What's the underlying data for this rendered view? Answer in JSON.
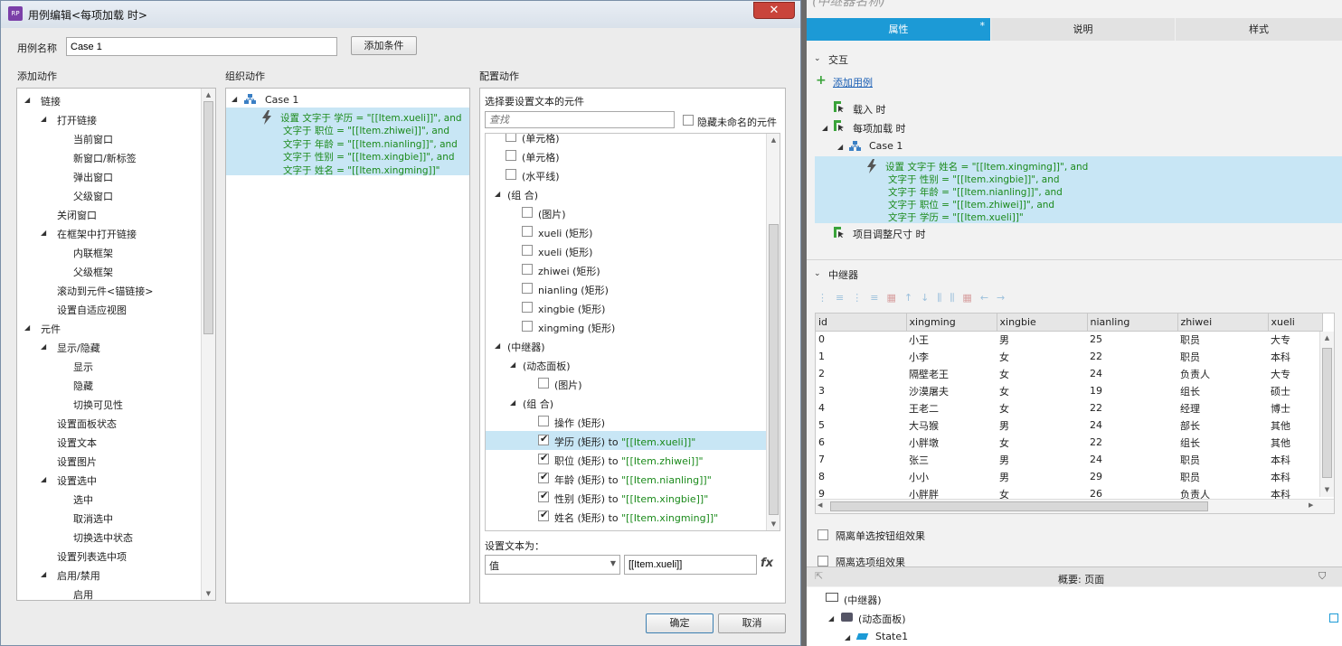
{
  "dialog": {
    "title": "用例编辑<每项加载 时>",
    "case_name_label": "用例名称",
    "case_name_value": "Case 1",
    "add_condition": "添加条件",
    "ok": "确定",
    "cancel": "取消"
  },
  "actions": {
    "header": "添加动作",
    "items": [
      {
        "label": "链接",
        "level": 0,
        "expand": true
      },
      {
        "label": "打开链接",
        "level": 1,
        "expand": true
      },
      {
        "label": "当前窗口",
        "level": 2
      },
      {
        "label": "新窗口/新标签",
        "level": 2
      },
      {
        "label": "弹出窗口",
        "level": 2
      },
      {
        "label": "父级窗口",
        "level": 2
      },
      {
        "label": "关闭窗口",
        "level": 1
      },
      {
        "label": "在框架中打开链接",
        "level": 1,
        "expand": true
      },
      {
        "label": "内联框架",
        "level": 2
      },
      {
        "label": "父级框架",
        "level": 2
      },
      {
        "label": "滚动到元件<锚链接>",
        "level": 1
      },
      {
        "label": "设置自适应视图",
        "level": 1
      },
      {
        "label": "元件",
        "level": 0,
        "expand": true
      },
      {
        "label": "显示/隐藏",
        "level": 1,
        "expand": true
      },
      {
        "label": "显示",
        "level": 2
      },
      {
        "label": "隐藏",
        "level": 2
      },
      {
        "label": "切换可见性",
        "level": 2
      },
      {
        "label": "设置面板状态",
        "level": 1
      },
      {
        "label": "设置文本",
        "level": 1
      },
      {
        "label": "设置图片",
        "level": 1
      },
      {
        "label": "设置选中",
        "level": 1,
        "expand": true
      },
      {
        "label": "选中",
        "level": 2
      },
      {
        "label": "取消选中",
        "level": 2
      },
      {
        "label": "切换选中状态",
        "level": 2
      },
      {
        "label": "设置列表选中项",
        "level": 1
      },
      {
        "label": "启用/禁用",
        "level": 1,
        "expand": true
      },
      {
        "label": "启用",
        "level": 2
      }
    ]
  },
  "organize": {
    "header": "组织动作",
    "case_label": "Case 1",
    "action_lines": [
      "设置 文字于 学历 = \"[[Item.xueli]]\", and",
      "文字于 职位 = \"[[Item.zhiwei]]\", and",
      "文字于 年龄 = \"[[Item.nianling]]\", and",
      "文字于 性别 = \"[[Item.xingbie]]\", and",
      "文字于 姓名 = \"[[Item.xingming]]\""
    ]
  },
  "configure": {
    "header": "配置动作",
    "select_label": "选择要设置文本的元件",
    "search_placeholder": "查找",
    "hide_unnamed": "隐藏未命名的元件",
    "items": [
      {
        "label": "(单元格)",
        "level": 1,
        "checkbox": true,
        "checked": false
      },
      {
        "label": "(单元格)",
        "level": 1,
        "checkbox": true,
        "checked": false
      },
      {
        "label": "(水平线)",
        "level": 1,
        "checkbox": true,
        "checked": false
      },
      {
        "label": "(组 合)",
        "level": 0,
        "checkbox": false,
        "expand": true
      },
      {
        "label": "(图片)",
        "level": 2,
        "checkbox": true,
        "checked": false
      },
      {
        "label": "xueli (矩形)",
        "level": 2,
        "checkbox": true,
        "checked": false
      },
      {
        "label": "xueli (矩形)",
        "level": 2,
        "checkbox": true,
        "checked": false
      },
      {
        "label": "zhiwei (矩形)",
        "level": 2,
        "checkbox": true,
        "checked": false
      },
      {
        "label": "nianling (矩形)",
        "level": 2,
        "checkbox": true,
        "checked": false
      },
      {
        "label": "xingbie (矩形)",
        "level": 2,
        "checkbox": true,
        "checked": false
      },
      {
        "label": "xingming (矩形)",
        "level": 2,
        "checkbox": true,
        "checked": false
      },
      {
        "label": "(中继器)",
        "level": 0,
        "checkbox": false,
        "expand": true
      },
      {
        "label": "(动态面板)",
        "level": 1,
        "checkbox": false,
        "expand": true
      },
      {
        "label": "(图片)",
        "level": 3,
        "checkbox": true,
        "checked": false
      },
      {
        "label": "(组 合)",
        "level": 1,
        "checkbox": false,
        "expand": true
      },
      {
        "label": "操作 (矩形)",
        "level": 3,
        "checkbox": true,
        "checked": false
      },
      {
        "label": "学历 (矩形) to ",
        "suffix": "\"[[Item.xueli]]\"",
        "level": 3,
        "checkbox": true,
        "checked": true,
        "selected": true
      },
      {
        "label": "职位 (矩形) to ",
        "suffix": "\"[[Item.zhiwei]]\"",
        "level": 3,
        "checkbox": true,
        "checked": true
      },
      {
        "label": "年龄 (矩形) to ",
        "suffix": "\"[[Item.nianling]]\"",
        "level": 3,
        "checkbox": true,
        "checked": true
      },
      {
        "label": "性别 (矩形) to ",
        "suffix": "\"[[Item.xingbie]]\"",
        "level": 3,
        "checkbox": true,
        "checked": true
      },
      {
        "label": "姓名 (矩形) to ",
        "suffix": "\"[[Item.xingming]]\"",
        "level": 3,
        "checkbox": true,
        "checked": true
      }
    ],
    "set_text_label": "设置文本为：",
    "value_type": "值",
    "value_text": "[[Item.xueli]]",
    "fx": "fx"
  },
  "right": {
    "widget_name": "(中继器名称)",
    "tabs": [
      "属性",
      "说明",
      "样式"
    ],
    "active_tab_mark": "*",
    "interaction_label": "交互",
    "add_case": "添加用例",
    "events": [
      {
        "label": "载入 时",
        "level": 1
      },
      {
        "label": "每项加载 时",
        "level": 1,
        "expand": true
      },
      {
        "label": "Case 1",
        "level": 2,
        "expand": true
      }
    ],
    "action_lines": [
      "设置 文字于 姓名 = \"[[Item.xingming]]\", and",
      "文字于 性别 = \"[[Item.xingbie]]\", and",
      "文字于 年龄 = \"[[Item.nianling]]\", and",
      "文字于 职位 = \"[[Item.zhiwei]]\", and",
      "文字于 学历 = \"[[Item.xueli]]\""
    ],
    "resize_event": "项目调整尺寸 时",
    "repeater_label": "中继器",
    "columns": [
      "id",
      "xingming",
      "xingbie",
      "nianling",
      "zhiwei",
      "xueli"
    ],
    "rows": [
      [
        "0",
        "小王",
        "男",
        "25",
        "职员",
        "大专"
      ],
      [
        "1",
        "小李",
        "女",
        "22",
        "职员",
        "本科"
      ],
      [
        "2",
        "隔壁老王",
        "女",
        "24",
        "负责人",
        "大专"
      ],
      [
        "3",
        "沙漠屠夫",
        "女",
        "19",
        "组长",
        "硕士"
      ],
      [
        "4",
        "王老二",
        "女",
        "22",
        "经理",
        "博士"
      ],
      [
        "5",
        "大马猴",
        "男",
        "24",
        "部长",
        "其他"
      ],
      [
        "6",
        "小胖墩",
        "女",
        "22",
        "组长",
        "其他"
      ],
      [
        "7",
        "张三",
        "男",
        "24",
        "职员",
        "本科"
      ],
      [
        "8",
        "小小",
        "男",
        "29",
        "职员",
        "本科"
      ],
      [
        "9",
        "小胖胖",
        "女",
        "26",
        "负责人",
        "本科"
      ]
    ],
    "isolate_radio": "隔离单选按钮组效果",
    "isolate_option": "隔离选项组效果",
    "outline_title": "概要: 页面",
    "outline_items": [
      {
        "label": "(中继器)",
        "level": 0
      },
      {
        "label": "(动态面板)",
        "level": 1
      },
      {
        "label": "State1",
        "level": 2
      }
    ]
  }
}
